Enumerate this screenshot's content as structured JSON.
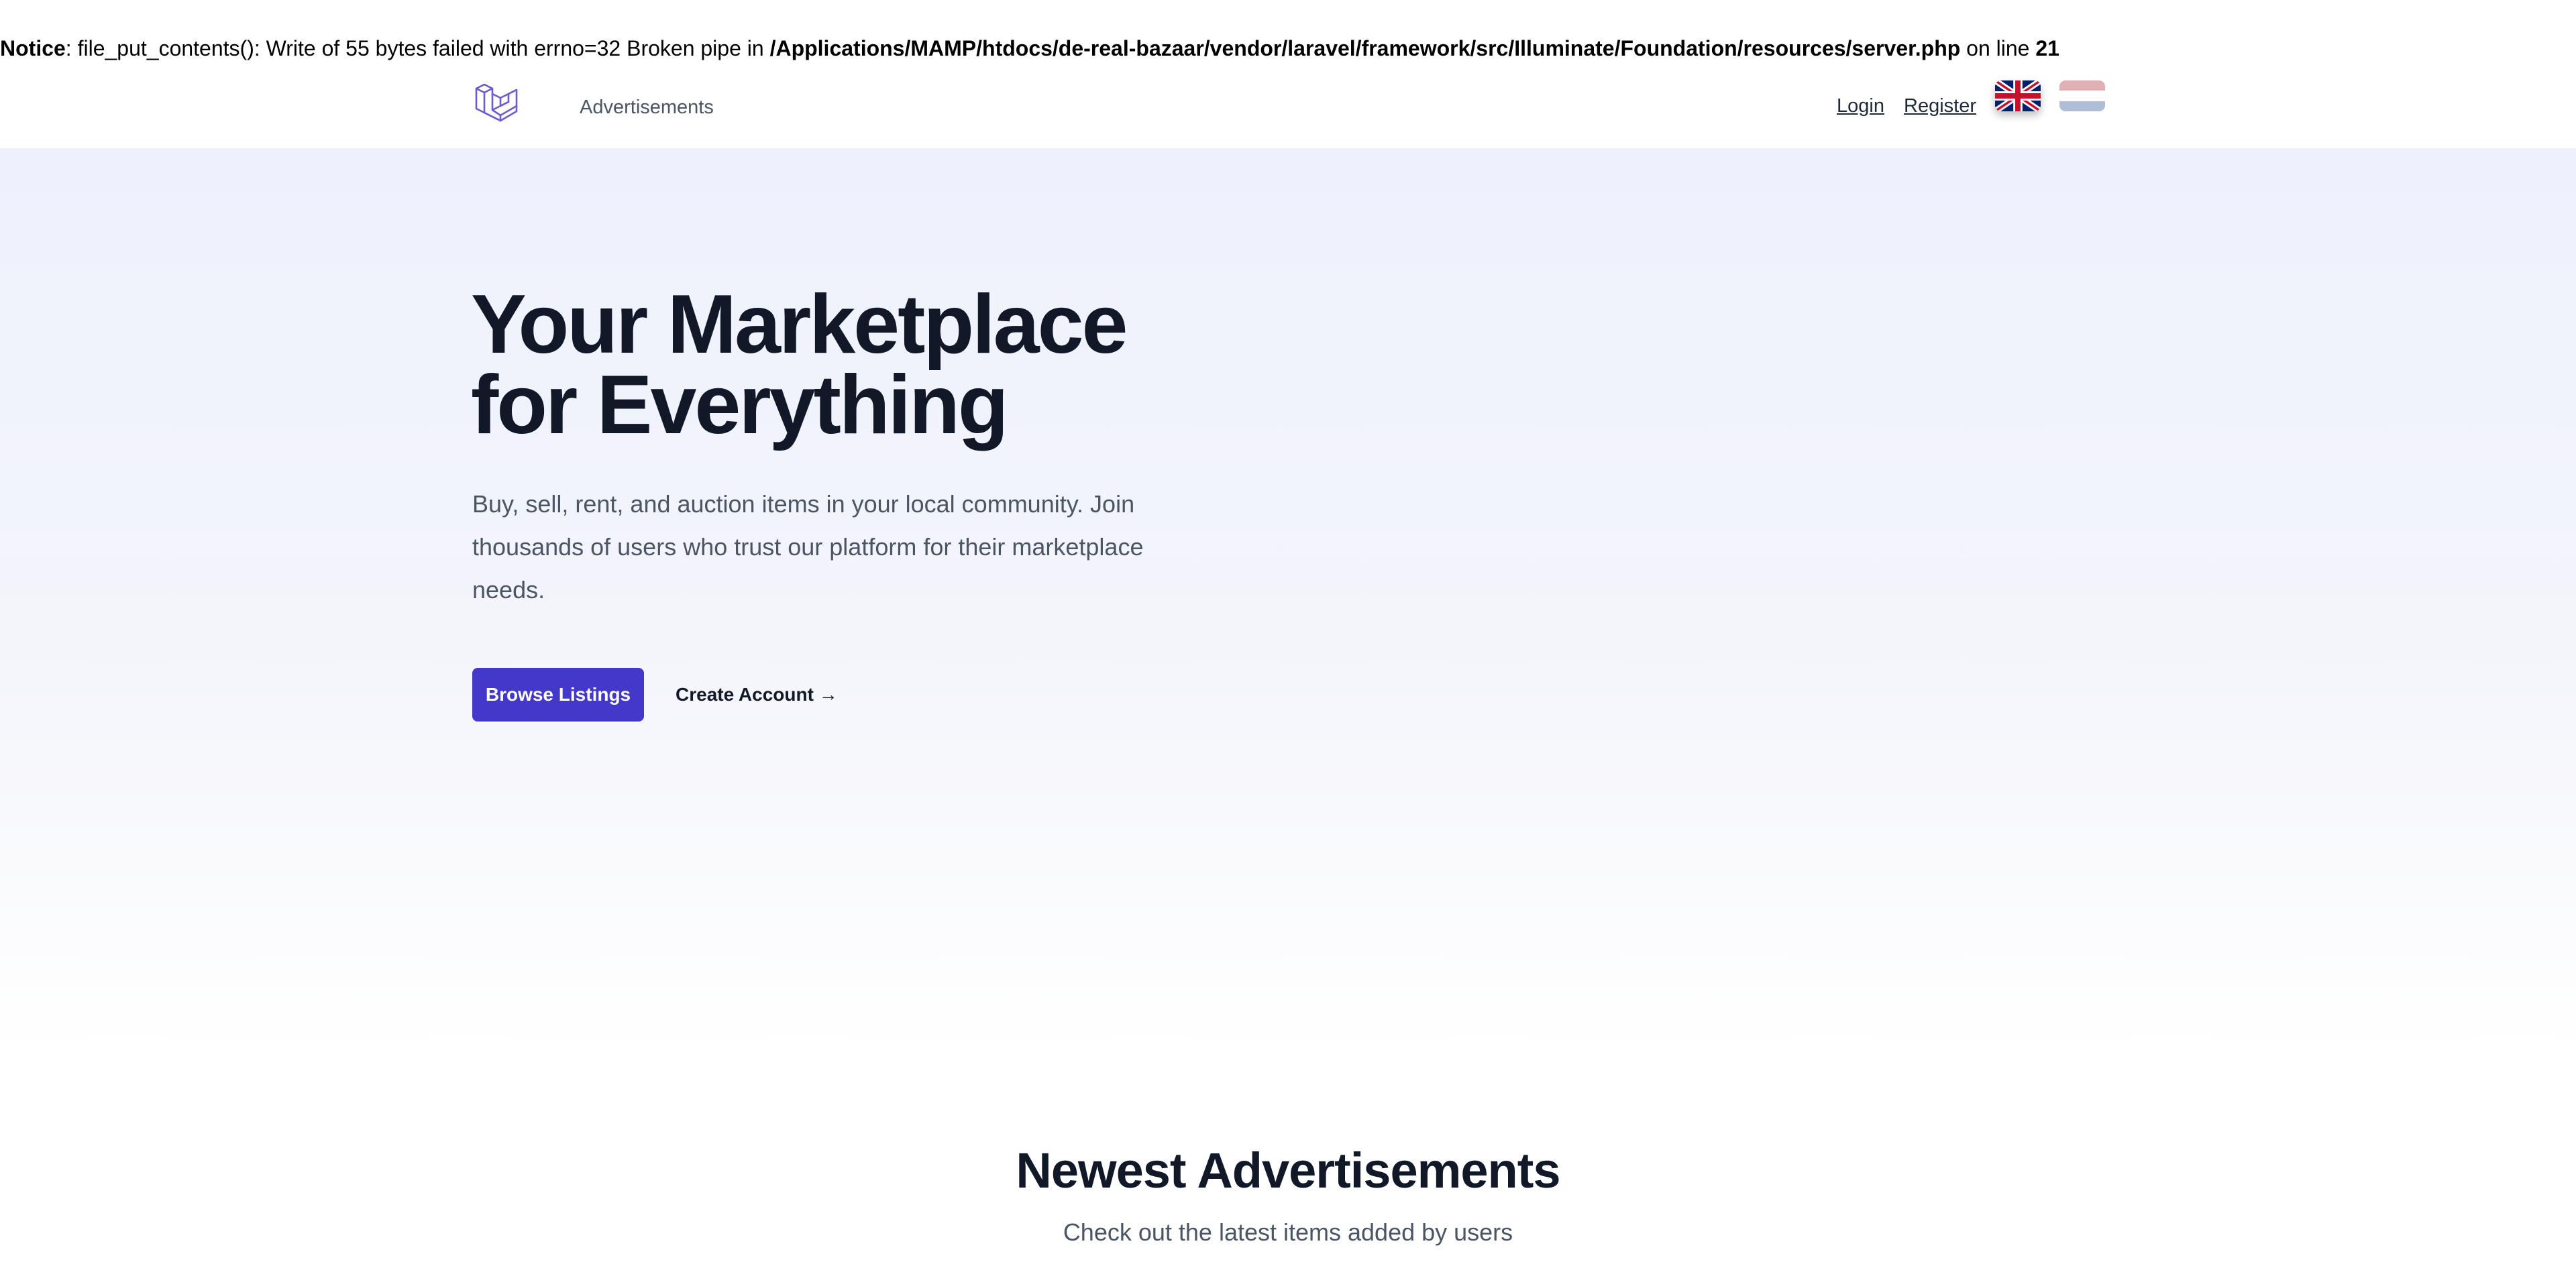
{
  "notice": {
    "label": "Notice",
    "message": ": file_put_contents(): Write of 55 bytes failed with errno=32 Broken pipe in ",
    "path": "/Applications/MAMP/htdocs/de-real-bazaar/vendor/laravel/framework/src/Illuminate/Foundation/resources/server.php",
    "line_text": " on line ",
    "line_number": "21"
  },
  "nav": {
    "logo_icon": "laravel-logo-icon",
    "advertisements": "Advertisements",
    "login": "Login",
    "register": "Register",
    "languages": [
      {
        "icon": "uk-flag-icon",
        "active": true
      },
      {
        "icon": "netherlands-flag-icon",
        "active": false
      }
    ]
  },
  "hero": {
    "title_line1": "Your Marketplace",
    "title_line2": "for Everything",
    "description": "Buy, sell, rent, and auction items in your local community. Join thousands of users who trust our platform for their marketplace needs.",
    "primary_button": "Browse Listings",
    "secondary_link": "Create Account →"
  },
  "newest": {
    "title": "Newest Advertisements",
    "subtitle": "Check out the latest items added by users"
  },
  "colors": {
    "accent": "#4338ca",
    "logo": "#6d5bd0",
    "heading": "#111827",
    "body_text": "#4b5563",
    "hero_bg_top": "#eef1fd"
  }
}
